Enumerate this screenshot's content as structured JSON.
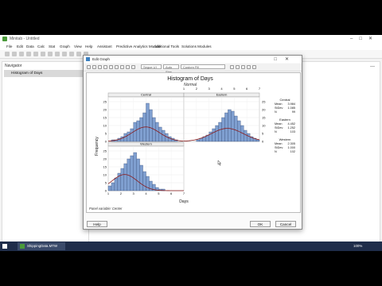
{
  "app": {
    "title": "Minitab - Untitled",
    "menu": [
      "File",
      "Edit",
      "Data",
      "Calc",
      "Stat",
      "Graph",
      "View",
      "Help",
      "Assistant",
      "Predictive Analytics Module",
      "Additional Tools",
      "Solutions Modules"
    ]
  },
  "navigator": {
    "header": "Navigator",
    "items": [
      "Histogram of Days"
    ]
  },
  "doc": {
    "partial_title": "Hi"
  },
  "dialog": {
    "title": "Edit Graph",
    "toolbar": {
      "font_select": "Segoe UI",
      "size_select": "Auto Size",
      "fill_select": "Custom Fill"
    },
    "help_label": "Help",
    "ok_label": "OK",
    "cancel_label": "Cancel"
  },
  "statusbar": {
    "filename": "ShippingData.MTW",
    "zoom": "100%"
  },
  "chart_data": {
    "type": "histogram",
    "title": "Histogram of Days",
    "subtitle": "Normal",
    "xlabel": "Days",
    "ylabel": "Frequency",
    "panel_variable": "Panel variable: Center",
    "x_ticks": [
      1,
      2,
      3,
      4,
      5,
      6,
      7
    ],
    "y_ticks": [
      0,
      5,
      10,
      15,
      20,
      25
    ],
    "ylim": [
      0,
      28
    ],
    "bin_edges": [
      1.0,
      1.25,
      1.5,
      1.75,
      2.0,
      2.25,
      2.5,
      2.75,
      3.0,
      3.25,
      3.5,
      3.75,
      4.0,
      4.25,
      4.5,
      4.75,
      5.0,
      5.25,
      5.5,
      5.75,
      6.0,
      6.25,
      6.5,
      6.75,
      7.0
    ],
    "panels": [
      {
        "name": "Central",
        "mean": "3.984",
        "stdev": "1.085",
        "n": "99",
        "counts": [
          0,
          1,
          1,
          2,
          3,
          5,
          6,
          8,
          12,
          13,
          15,
          18,
          24,
          20,
          15,
          12,
          9,
          7,
          5,
          3,
          2,
          1,
          0,
          0
        ]
      },
      {
        "name": "Eastern",
        "mean": "4.452",
        "stdev": "1.252",
        "n": "103",
        "counts": [
          0,
          0,
          0,
          0,
          1,
          2,
          3,
          4,
          6,
          8,
          10,
          12,
          15,
          18,
          20,
          19,
          16,
          13,
          10,
          7,
          5,
          3,
          2,
          1
        ]
      },
      {
        "name": "Western",
        "mean": "2.305",
        "stdev": "1.000",
        "n": "102",
        "counts": [
          3,
          5,
          8,
          11,
          14,
          17,
          20,
          22,
          24,
          20,
          16,
          12,
          9,
          6,
          4,
          2,
          1,
          1,
          0,
          0,
          0,
          0,
          0,
          0
        ]
      }
    ],
    "legend_labels": {
      "mean": "Mean",
      "stdev": "StDev",
      "n": "N"
    },
    "colors": {
      "bar_fill": "#7f9fd0",
      "bar_edge": "#3b4f7a",
      "curve": "#8b1a1a",
      "panel_header": "#eeeeee"
    }
  }
}
